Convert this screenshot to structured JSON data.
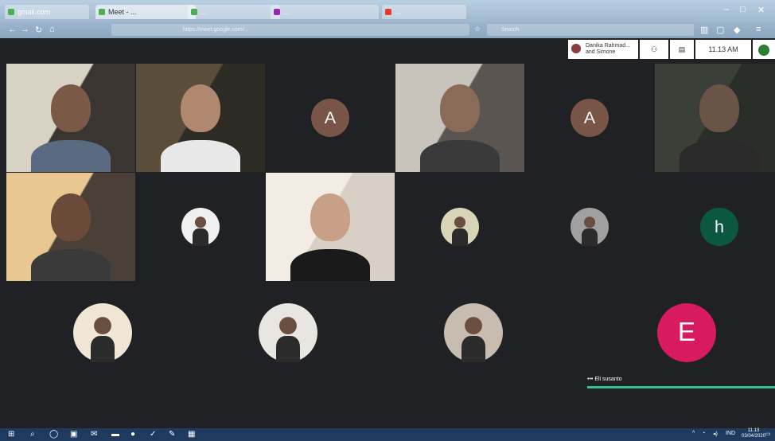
{
  "browser": {
    "tabs": [
      {
        "label": "gmail.com",
        "color": "#4caf50"
      },
      {
        "label": "Meet - ...",
        "color": "#4caf50"
      },
      {
        "label": "...",
        "color": "#4caf50"
      },
      {
        "label": "...",
        "color": "#9c27b0"
      },
      {
        "label": "...",
        "color": "#e53935"
      }
    ],
    "url": "https://meet.google.com/...",
    "search_placeholder": "Search"
  },
  "meet": {
    "presenter": {
      "line1": "Danika Rahmad...",
      "line2": "and Simone"
    },
    "time": "11.13 AM",
    "tiles": [
      {
        "kind": "video",
        "bg": "#3a3530",
        "face": "#7a5a46",
        "shirt": "#5a6a80",
        "wall": "#d8d2c4"
      },
      {
        "kind": "video",
        "bg": "#2e2a24",
        "face": "#b08870",
        "shirt": "#e8e8e8",
        "wall": "#5a4d3a"
      },
      {
        "kind": "avatar",
        "letter": "A",
        "color": "#795548"
      },
      {
        "kind": "video",
        "bg": "#5a5550",
        "face": "#8a6a58",
        "shirt": "#3a3a3a",
        "wall": "#c8c4bc"
      },
      {
        "kind": "avatar",
        "letter": "A",
        "color": "#795548"
      },
      {
        "kind": "video",
        "bg": "#2a2e28",
        "face": "#6a5448",
        "shirt": "#2a2a2a",
        "wall": "#3a4038"
      },
      {
        "kind": "video",
        "bg": "#4a4038",
        "face": "#6a4a38",
        "shirt": "#3a3a3a",
        "wall": "#e8c890"
      },
      {
        "kind": "photo",
        "color": "#f0f0f0"
      },
      {
        "kind": "video",
        "bg": "#d8d0c4",
        "face": "#c8a088",
        "shirt": "#1a1a1a",
        "wall": "#f2ece4"
      },
      {
        "kind": "photo",
        "color": "#d9d4b8"
      },
      {
        "kind": "photo",
        "color": "#a0a0a0"
      },
      {
        "kind": "avatar",
        "letter": "h",
        "color": "#0b5840"
      },
      {
        "kind": "photo",
        "color": "#efe6d6"
      },
      {
        "kind": "photo",
        "color": "#e8e6e0"
      },
      {
        "kind": "photo",
        "color": "#c8bcb0"
      },
      {
        "kind": "avatar",
        "letter": "E",
        "color": "#d81b60"
      }
    ],
    "active_speaker": "Eli susanto"
  },
  "taskbar": {
    "clock": "11.13",
    "date": "03/04/2020",
    "lang": "IND"
  }
}
